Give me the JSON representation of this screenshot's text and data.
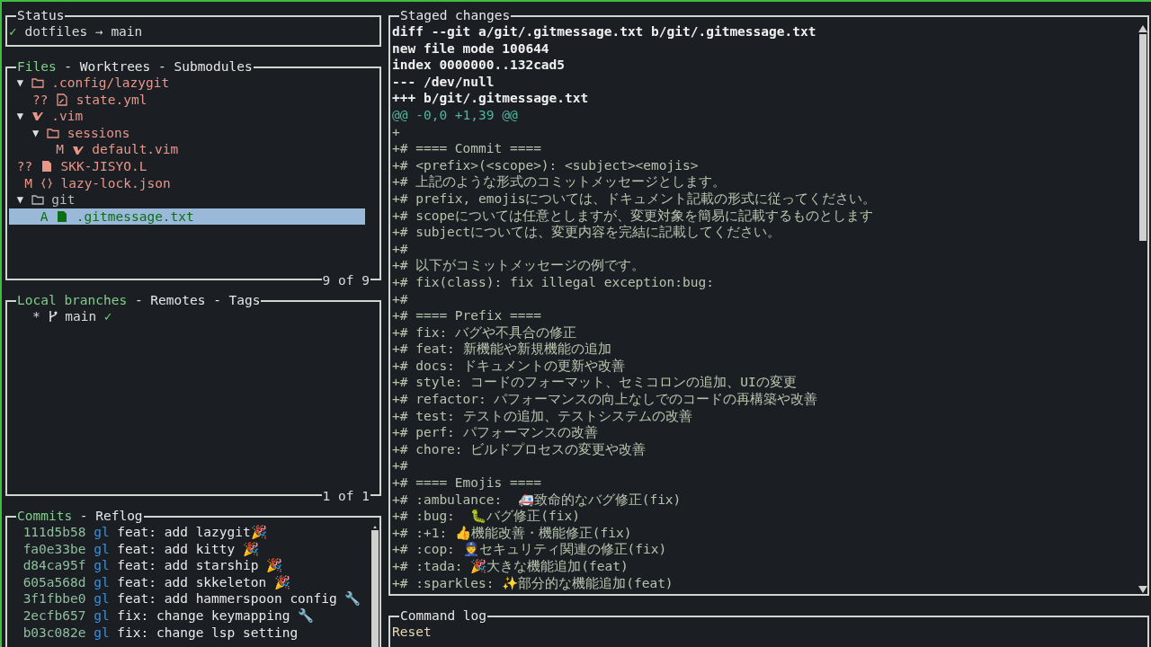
{
  "status": {
    "title": "Status",
    "check": "✓",
    "repo": "dotfiles",
    "arrow": "→",
    "branch": "main"
  },
  "files": {
    "tabs": [
      {
        "label": "Files",
        "selected": true
      },
      {
        "label": "Worktrees",
        "selected": false
      },
      {
        "label": "Submodules",
        "selected": false
      }
    ],
    "separator": "-",
    "footer": "9 of 9",
    "items": [
      {
        "kind": "folder",
        "toggle": "▼",
        "name": ".config/lazygit",
        "selected": false,
        "staged": false,
        "children": [
          {
            "kind": "yaml",
            "status": "??",
            "name": "state.yml",
            "selected": false
          }
        ]
      },
      {
        "kind": "vimfolder",
        "toggle": "▼",
        "name": ".vim",
        "selected": false,
        "staged": false,
        "children": [
          {
            "kind": "folder",
            "toggle": "▼",
            "name": "sessions",
            "selected": false,
            "staged": false,
            "children": [
              {
                "kind": "vim",
                "status": "M",
                "name": "default.vim",
                "selected": false
              }
            ]
          }
        ]
      },
      {
        "kind": "text",
        "status": "??",
        "name": "SKK-JISYO.L",
        "selected": false
      },
      {
        "kind": "json",
        "status": "M",
        "name": "lazy-lock.json",
        "selected": false
      },
      {
        "kind": "folder",
        "toggle": "▼",
        "name": "git",
        "selected": false,
        "staged": true,
        "children": [
          {
            "kind": "text",
            "status": "A",
            "name": ".gitmessage.txt",
            "selected": true
          }
        ]
      }
    ]
  },
  "branches": {
    "tabs": [
      {
        "label": "Local branches",
        "selected": true
      },
      {
        "label": "Remotes",
        "selected": false
      },
      {
        "label": "Tags",
        "selected": false
      }
    ],
    "separator": "-",
    "footer": "1 of 1",
    "items": [
      {
        "marker": "*",
        "name": "main",
        "check": "✓",
        "selected": false
      }
    ]
  },
  "commits": {
    "tabs": [
      {
        "label": "Commits",
        "selected": true
      },
      {
        "label": "Reflog",
        "selected": false
      }
    ],
    "separator": "-",
    "rows": [
      {
        "hash": "111d5b58",
        "author": "gl",
        "message": "feat: add lazygit🎉"
      },
      {
        "hash": "fa0e33be",
        "author": "gl",
        "message": "feat: add kitty 🎉"
      },
      {
        "hash": "d84ca95f",
        "author": "gl",
        "message": "feat: add starship 🎉"
      },
      {
        "hash": "605a568d",
        "author": "gl",
        "message": "feat: add skkeleton 🎉"
      },
      {
        "hash": "3f1fbbe0",
        "author": "gl",
        "message": "feat: add hammerspoon config 🔧"
      },
      {
        "hash": "2ecfb657",
        "author": "gl",
        "message": "fix: change keymapping 🔧"
      },
      {
        "hash": "b03c082e",
        "author": "gl",
        "message": "fix: change lsp setting"
      }
    ]
  },
  "diff": {
    "title": "Staged changes",
    "lines": [
      {
        "kind": "header",
        "text": "diff --git a/git/.gitmessage.txt b/git/.gitmessage.txt"
      },
      {
        "kind": "header",
        "text": "new file mode 100644"
      },
      {
        "kind": "header",
        "text": "index 0000000..132cad5"
      },
      {
        "kind": "header",
        "text": "--- /dev/null"
      },
      {
        "kind": "header",
        "text": "+++ b/git/.gitmessage.txt"
      },
      {
        "kind": "hunk",
        "text": "@@ -0,0 +1,39 @@"
      },
      {
        "kind": "added",
        "text": "+"
      },
      {
        "kind": "added",
        "text": "+# ==== Commit ===="
      },
      {
        "kind": "added",
        "text": "+# <prefix>(<scope>): <subject><emojis>"
      },
      {
        "kind": "added",
        "text": "+# 上記のような形式のコミットメッセージとします。"
      },
      {
        "kind": "added",
        "text": "+# prefix, emojisについては、ドキュメント記載の形式に従ってください。"
      },
      {
        "kind": "added",
        "text": "+# scopeについては任意としますが、変更対象を簡易に記載するものとします"
      },
      {
        "kind": "added",
        "text": "+# subjectについては、変更内容を完結に記載してください。"
      },
      {
        "kind": "added",
        "text": "+#"
      },
      {
        "kind": "added",
        "text": "+# 以下がコミットメッセージの例です。"
      },
      {
        "kind": "added",
        "text": "+# fix(class): fix illegal exception:bug:"
      },
      {
        "kind": "added",
        "text": "+#"
      },
      {
        "kind": "added",
        "text": "+# ==== Prefix ===="
      },
      {
        "kind": "added",
        "text": "+# fix: バグや不具合の修正"
      },
      {
        "kind": "added",
        "text": "+# feat: 新機能や新規機能の追加"
      },
      {
        "kind": "added",
        "text": "+# docs: ドキュメントの更新や改善"
      },
      {
        "kind": "added",
        "text": "+# style: コードのフォーマット、セミコロンの追加、UIの変更"
      },
      {
        "kind": "added",
        "text": "+# refactor: パフォーマンスの向上なしでのコードの再構築や改善"
      },
      {
        "kind": "added",
        "text": "+# test: テストの追加、テストシステムの改善"
      },
      {
        "kind": "added",
        "text": "+# perf: パフォーマンスの改善"
      },
      {
        "kind": "added",
        "text": "+# chore: ビルドプロセスの変更や改善"
      },
      {
        "kind": "added",
        "text": "+#"
      },
      {
        "kind": "added",
        "text": "+# ==== Emojis ===="
      },
      {
        "kind": "added",
        "text": "+# :ambulance:  🚑致命的なバグ修正(fix)"
      },
      {
        "kind": "added",
        "text": "+# :bug:  🐛バグ修正(fix)"
      },
      {
        "kind": "added",
        "text": "+# :+1: 👍機能改善・機能修正(fix)"
      },
      {
        "kind": "added",
        "text": "+# :cop: 👮セキュリティ関連の修正(fix)"
      },
      {
        "kind": "added",
        "text": "+# :tada: 🎉大きな機能追加(feat)"
      },
      {
        "kind": "added",
        "text": "+# :sparkles: ✨部分的な機能追加(feat)"
      }
    ]
  },
  "command_log": {
    "title": "Command log",
    "lines": [
      {
        "kind": "action",
        "text": "Reset"
      }
    ]
  }
}
